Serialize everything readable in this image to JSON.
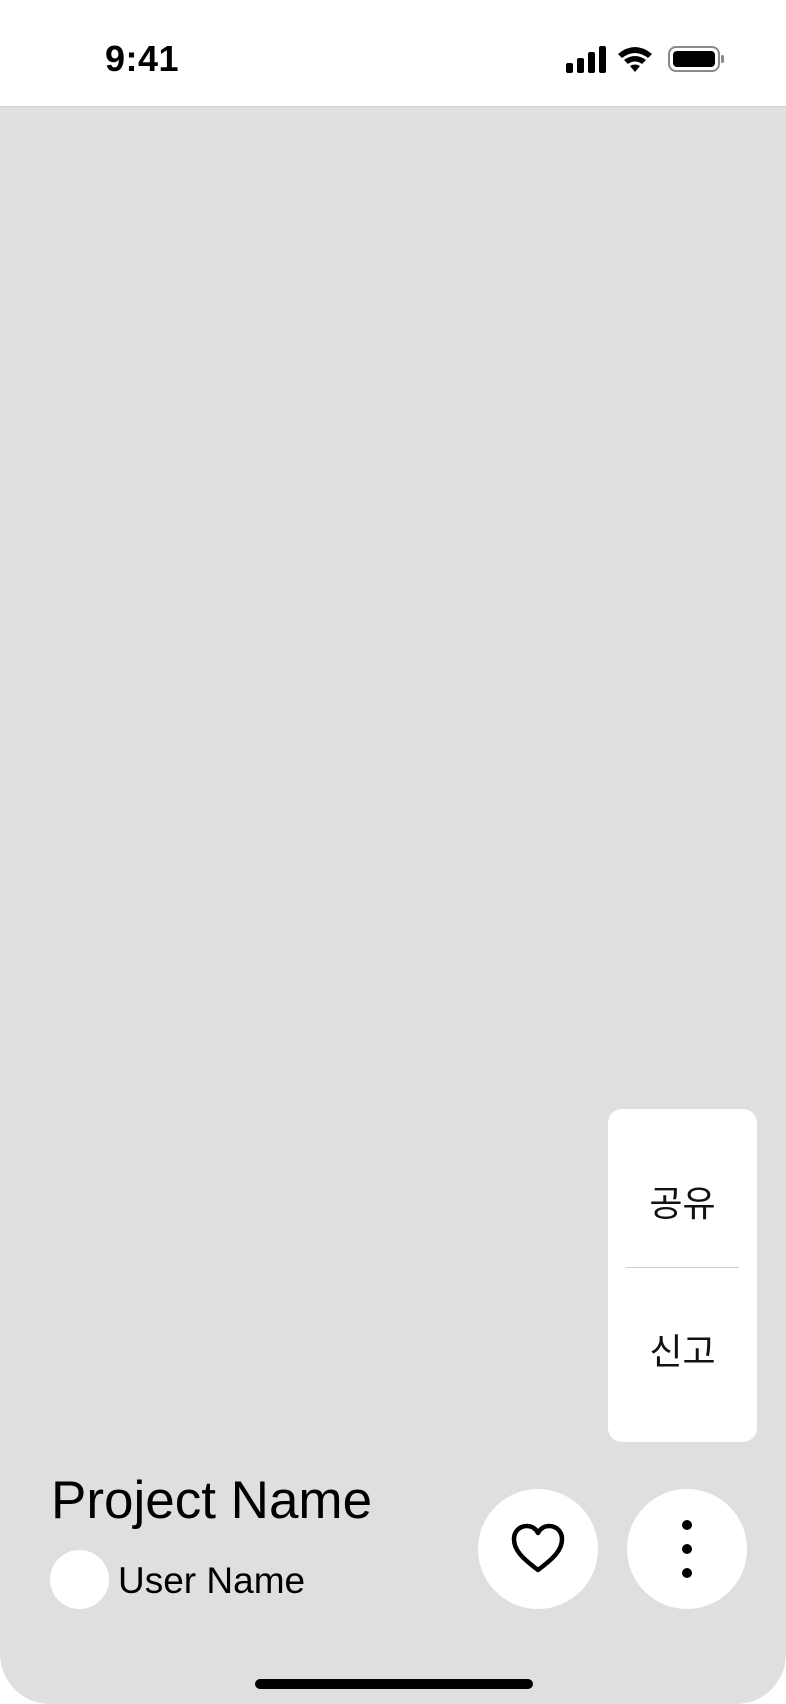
{
  "status_bar": {
    "time": "9:41",
    "icons": [
      "cellular-signal-icon",
      "wifi-icon",
      "battery-icon"
    ]
  },
  "colors": {
    "background": "#dfdfdf",
    "surface": "#ffffff",
    "text": "#000000"
  },
  "context_menu": {
    "items": [
      {
        "label": "공유"
      },
      {
        "label": "신고"
      }
    ]
  },
  "project": {
    "title": "Project Name",
    "user_name": "User Name"
  },
  "actions": {
    "like_icon": "heart-icon",
    "more_icon": "more-vertical-icon"
  }
}
